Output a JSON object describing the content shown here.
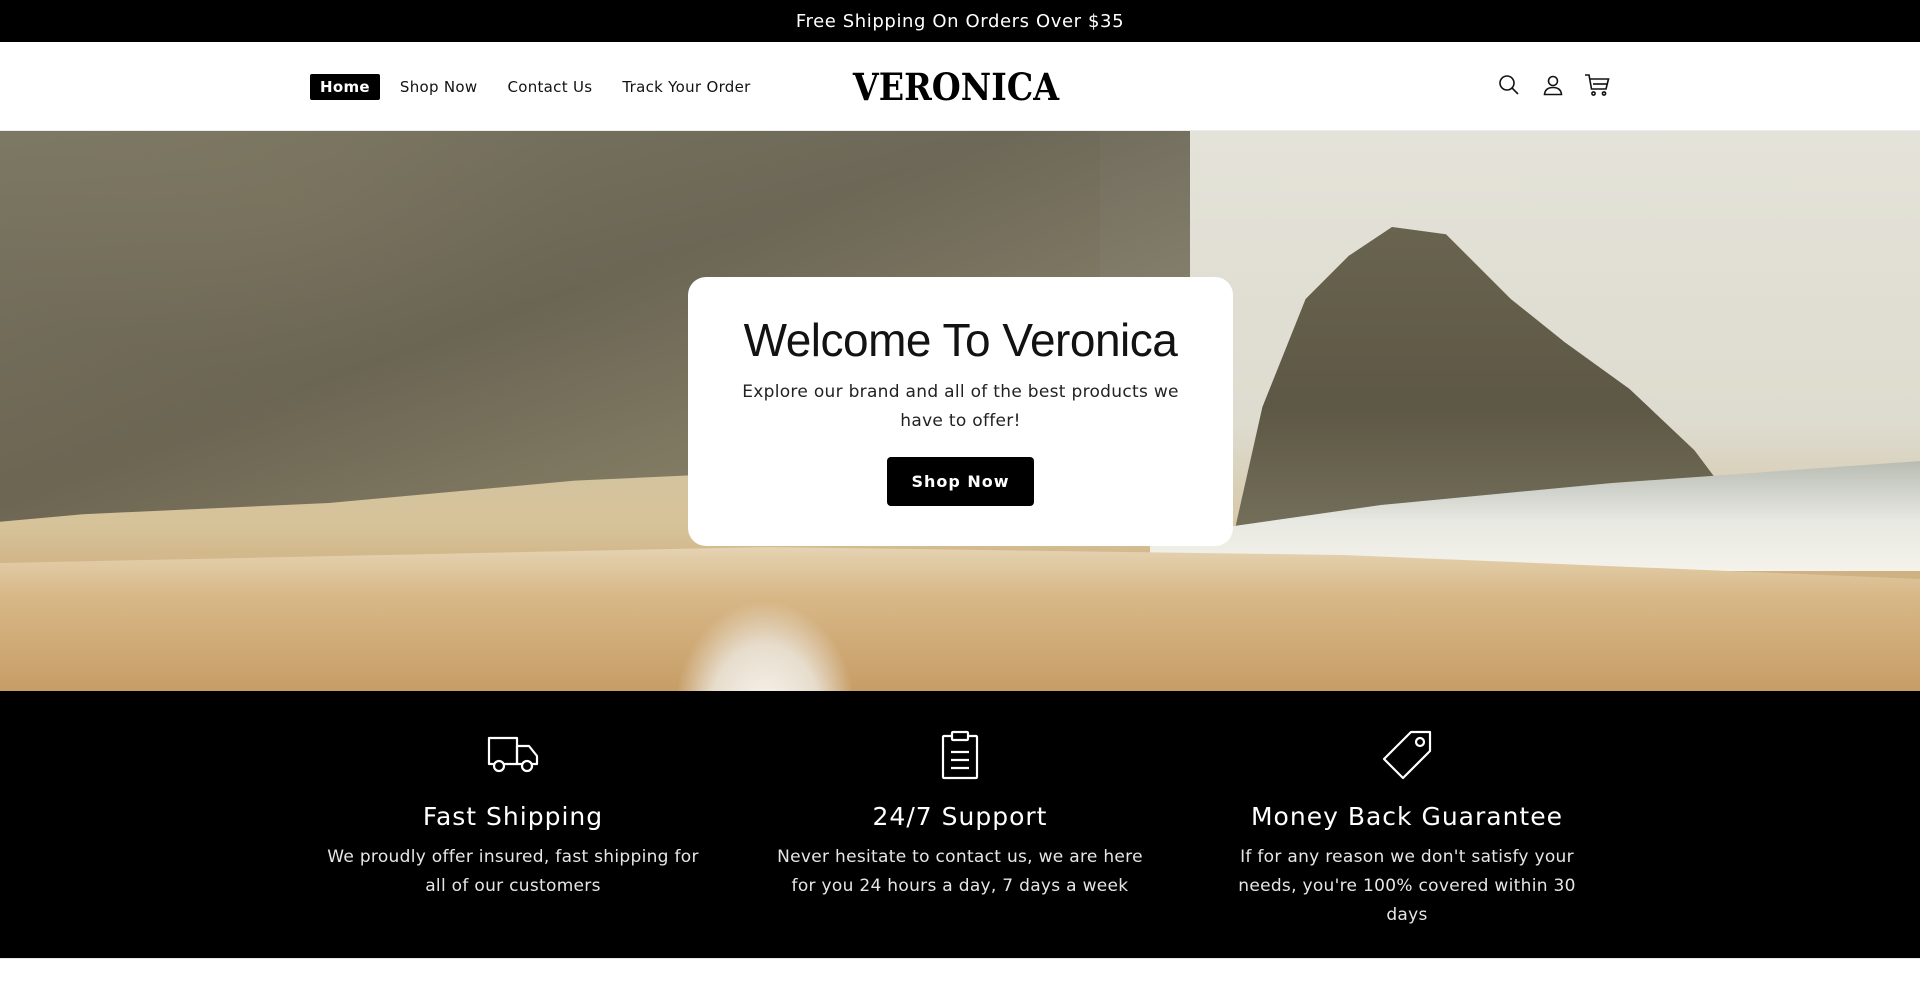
{
  "announcement": {
    "text": "Free Shipping On Orders Over $35"
  },
  "header": {
    "logo": "VERONICA",
    "nav": [
      {
        "label": "Home",
        "active": true
      },
      {
        "label": "Shop Now",
        "active": false
      },
      {
        "label": "Contact Us",
        "active": false
      },
      {
        "label": "Track Your Order",
        "active": false
      }
    ],
    "icons": [
      "search-icon",
      "account-icon",
      "cart-icon"
    ]
  },
  "hero": {
    "title": "Welcome To Veronica",
    "text": "Explore our brand and all of the best products we have to offer!",
    "button_label": "Shop Now"
  },
  "features": [
    {
      "icon": "truck-icon",
      "title": "Fast Shipping",
      "text": "We proudly offer insured, fast shipping for all of our customers"
    },
    {
      "icon": "clipboard-icon",
      "title": "24/7 Support",
      "text": "Never hesitate to contact us, we are here for you 24 hours a day, 7 days a week"
    },
    {
      "icon": "price-tag-icon",
      "title": "Money Back Guarantee",
      "text": "If for any reason we don't satisfy your needs, you're 100% covered within 30 days"
    }
  ],
  "colors": {
    "announcement_bg": "#000000",
    "features_bg": "#000000",
    "button_bg": "#000000",
    "text": "#121212"
  }
}
